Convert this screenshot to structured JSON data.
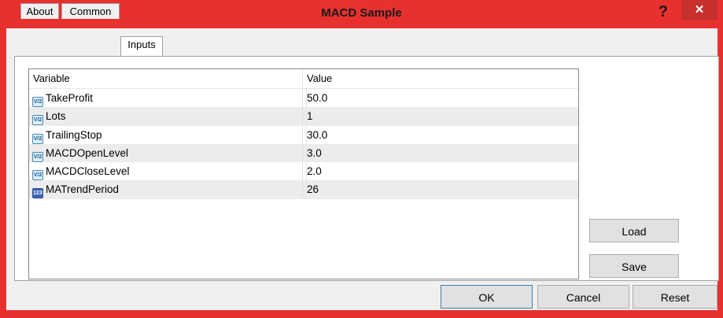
{
  "window": {
    "title": "MACD Sample",
    "help_label": "?",
    "close_label": "✕"
  },
  "tabs": [
    {
      "label": "About"
    },
    {
      "label": "Common"
    },
    {
      "label": "Inputs",
      "active": true
    }
  ],
  "table": {
    "headers": {
      "variable": "Variable",
      "value": "Value"
    },
    "rows": [
      {
        "variable": "TakeProfit",
        "value": "50.0",
        "icon": "double-type-icon",
        "icon_text": "V/2"
      },
      {
        "variable": "Lots",
        "value": "1",
        "icon": "double-type-icon",
        "icon_text": "V/2"
      },
      {
        "variable": "TrailingStop",
        "value": "30.0",
        "icon": "double-type-icon",
        "icon_text": "V/2"
      },
      {
        "variable": "MACDOpenLevel",
        "value": "3.0",
        "icon": "double-type-icon",
        "icon_text": "V/2"
      },
      {
        "variable": "MACDCloseLevel",
        "value": "2.0",
        "icon": "double-type-icon",
        "icon_text": "V/2"
      },
      {
        "variable": "MATrendPeriod",
        "value": "26",
        "icon": "integer-type-icon",
        "icon_text": "123"
      }
    ]
  },
  "buttons": {
    "load": "Load",
    "save": "Save",
    "ok": "OK",
    "cancel": "Cancel",
    "reset": "Reset"
  }
}
